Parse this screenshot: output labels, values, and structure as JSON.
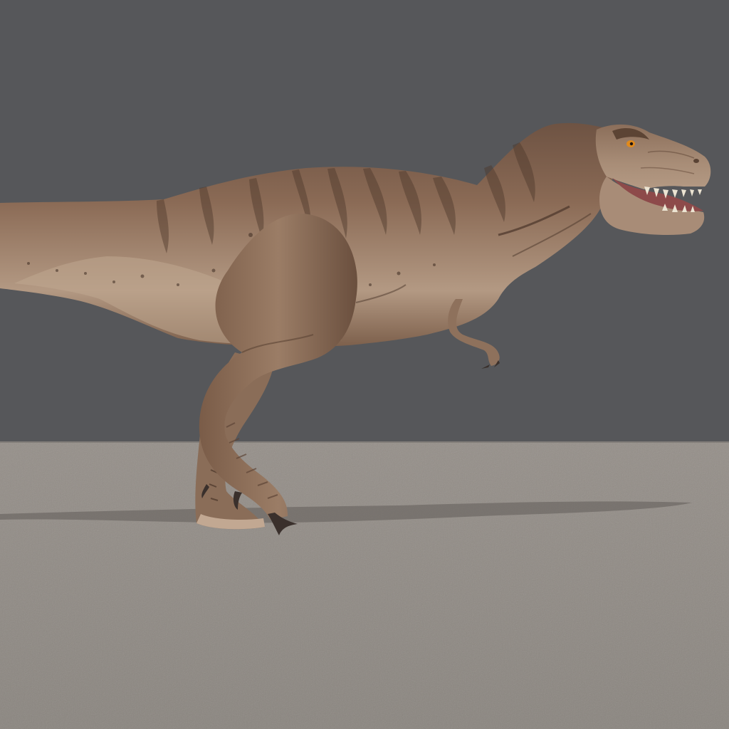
{
  "scene": {
    "subject": "tyrannosaurus-rex",
    "colors": {
      "backdrop": "#56575a",
      "floor": "#8c8680",
      "floor_far": "#958f89",
      "skin_base": "#8a6a55",
      "skin_light": "#b79d87",
      "skin_dark": "#5f4535",
      "stripe": "#4d382b",
      "mouth": "#8d4a4a",
      "teeth": "#ece4d2",
      "eye": "#e08a1c",
      "claw": "#3a302c",
      "shadow": "#6d6864"
    }
  }
}
